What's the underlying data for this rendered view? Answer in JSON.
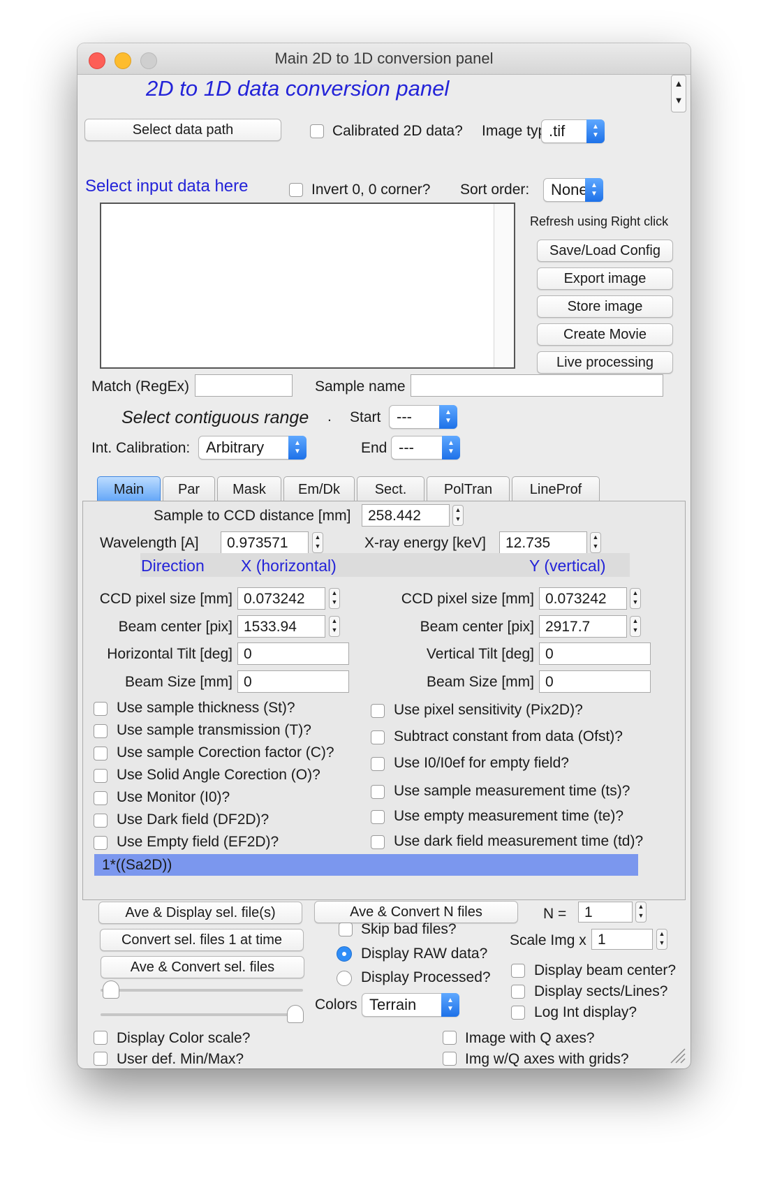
{
  "window": {
    "title": "Main 2D to 1D conversion panel"
  },
  "header": {
    "title": "2D to 1D data conversion panel"
  },
  "top": {
    "select_data_path": "Select data path",
    "calibrated_label": "Calibrated 2D data?",
    "image_type_label": "Image type",
    "image_type_value": ".tif"
  },
  "input": {
    "section_title": "Select input data here",
    "invert_label": "Invert 0, 0 corner?",
    "sort_order_label": "Sort order:",
    "sort_order_value": "None",
    "refresh_note": "Refresh using Right click"
  },
  "side_buttons": {
    "save_load": "Save/Load Config",
    "export_image": "Export image",
    "store_image": "Store image",
    "create_movie": "Create Movie",
    "live_processing": "Live processing"
  },
  "match": {
    "label": "Match (RegEx)",
    "value": ""
  },
  "sample": {
    "label": "Sample name",
    "value": ""
  },
  "range": {
    "title": "Select contiguous range",
    "dot": ".",
    "start_label": "Start",
    "start_value": "---",
    "end_label": "End",
    "end_value": "---"
  },
  "calibration": {
    "label": "Int. Calibration:",
    "value": "Arbitrary"
  },
  "tabs": [
    "Main",
    "Par",
    "Mask",
    "Em/Dk",
    "Sect.",
    "PolTran",
    "LineProf"
  ],
  "main_tab": {
    "distance_label": "Sample to CCD distance [mm]",
    "distance_value": "258.442",
    "wavelength_label": "Wavelength [A]",
    "wavelength_value": "0.973571",
    "energy_label": "X-ray energy [keV]",
    "energy_value": "12.735",
    "direction_label": "Direction",
    "x_header": "X (horizontal)",
    "y_header": "Y (vertical)",
    "x": {
      "pixel_label": "CCD pixel size [mm]",
      "pixel_value": "0.073242",
      "beam_label": "Beam center [pix]",
      "beam_value": "1533.94",
      "tilt_label": "Horizontal Tilt [deg]",
      "tilt_value": "0",
      "size_label": "Beam Size [mm]",
      "size_value": "0"
    },
    "y": {
      "pixel_label": "CCD pixel size [mm]",
      "pixel_value": "0.073242",
      "beam_label": "Beam center [pix]",
      "beam_value": "2917.7",
      "tilt_label": "Vertical Tilt [deg]",
      "tilt_value": "0",
      "size_label": "Beam Size [mm]",
      "size_value": "0"
    },
    "left_checks": [
      "Use sample thickness (St)?",
      "Use sample transmission (T)?",
      "Use sample Corection factor (C)?",
      "Use Solid Angle Corection (O)?",
      "Use Monitor (I0)?",
      "Use Dark field (DF2D)?",
      "Use Empty field (EF2D)?"
    ],
    "right_checks": [
      "Use pixel sensitivity (Pix2D)?",
      "Subtract constant from data (Ofst)?",
      "Use I0/I0ef for empty field?",
      "Use sample measurement time (ts)?",
      "Use empty measurement time (te)?",
      "Use dark field measurement time (td)?"
    ],
    "formula": "1*((Sa2D))"
  },
  "bottom": {
    "ave_display": "Ave & Display sel. file(s)",
    "convert_one": "Convert sel. files 1 at time",
    "ave_convert_sel": "Ave & Convert sel. files",
    "ave_convert_n": "Ave & Convert N files",
    "n_label": "N =",
    "n_value": "1",
    "skip_bad": "Skip bad files?",
    "display_raw": "Display RAW data?",
    "display_processed": "Display Processed?",
    "scale_label": "Scale Img x",
    "scale_value": "1",
    "display_beam_center": "Display beam center?",
    "display_sects": "Display sects/Lines?",
    "log_int": "Log Int display?",
    "colors_label": "Colors",
    "colors_value": "Terrain",
    "display_color_scale": "Display Color scale?",
    "user_def_minmax": "User def. Min/Max?",
    "image_q_axes": "Image with Q axes?",
    "img_q_grids": "Img w/Q axes with grids?"
  }
}
